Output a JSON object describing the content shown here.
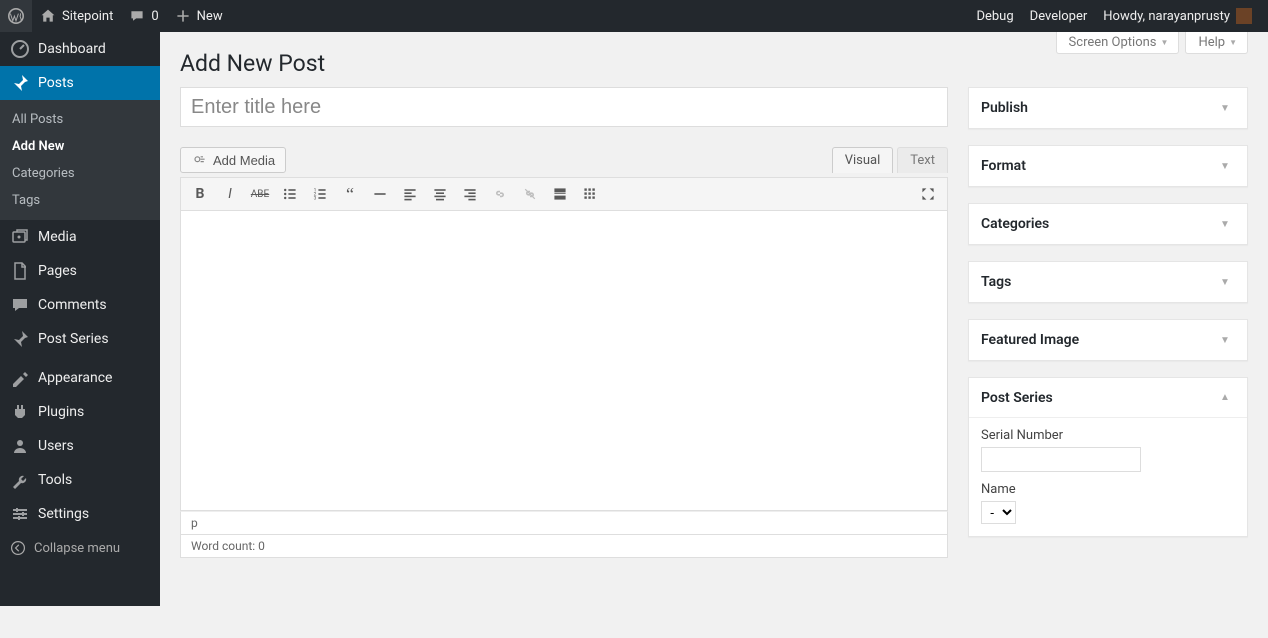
{
  "adminbar": {
    "site_name": "Sitepoint",
    "comments_count": "0",
    "new_label": "New",
    "debug_label": "Debug",
    "developer_label": "Developer",
    "howdy_label": "Howdy, narayanprusty"
  },
  "sidebar": {
    "dashboard": "Dashboard",
    "posts": "Posts",
    "posts_sub": {
      "all": "All Posts",
      "add_new": "Add New",
      "categories": "Categories",
      "tags": "Tags"
    },
    "media": "Media",
    "pages": "Pages",
    "comments": "Comments",
    "post_series": "Post Series",
    "appearance": "Appearance",
    "plugins": "Plugins",
    "users": "Users",
    "tools": "Tools",
    "settings": "Settings",
    "collapse": "Collapse menu"
  },
  "screen_meta": {
    "options": "Screen Options",
    "help": "Help"
  },
  "page": {
    "title": "Add New Post",
    "title_placeholder": "Enter title here"
  },
  "editor": {
    "add_media": "Add Media",
    "tabs": {
      "visual": "Visual",
      "text": "Text"
    },
    "path": "p",
    "word_count_label": "Word count: 0"
  },
  "metaboxes": {
    "publish": "Publish",
    "format": "Format",
    "categories": "Categories",
    "tags": "Tags",
    "featured_image": "Featured Image",
    "post_series": {
      "title": "Post Series",
      "serial_label": "Serial Number",
      "name_label": "Name",
      "name_options": [
        "-"
      ]
    }
  }
}
